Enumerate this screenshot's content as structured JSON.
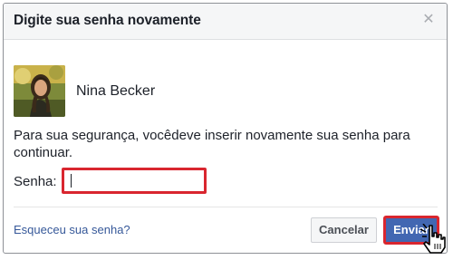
{
  "dialog": {
    "title": "Digite sua senha novamente",
    "close_icon": "close-icon"
  },
  "user": {
    "name": "Nina Becker",
    "avatar": "user-avatar-photo"
  },
  "message": "Para sua segurança, vocêdeve inserir novamente sua senha para continuar.",
  "password": {
    "label": "Senha:",
    "value": ""
  },
  "footer": {
    "forgot_link": "Esqueceu sua senha?",
    "cancel_label": "Cancelar",
    "submit_label": "Enviar"
  },
  "colors": {
    "highlight": "#d9262f",
    "primary_button": "#4267b2",
    "link": "#365899"
  },
  "pointer_icon": "hand-pointer-icon"
}
